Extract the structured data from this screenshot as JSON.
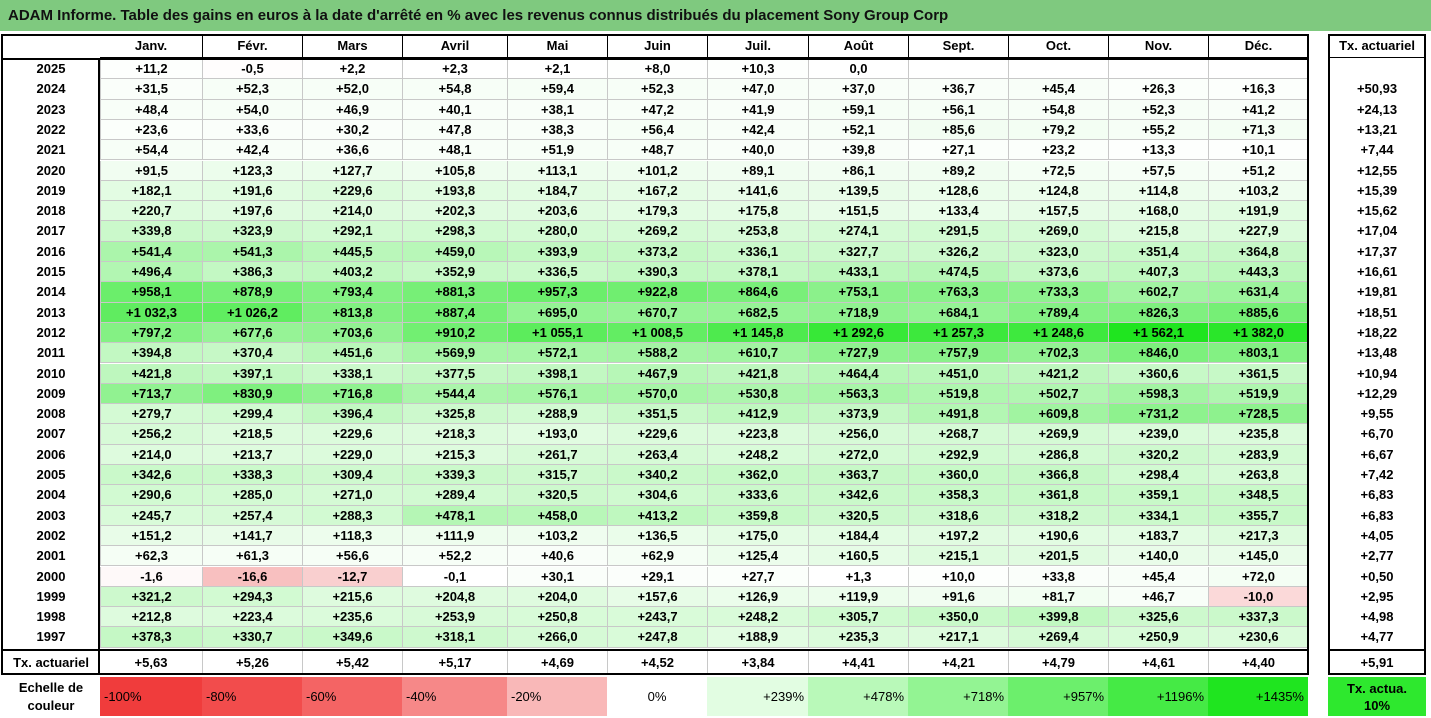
{
  "title": "ADAM Informe. Table des gains en euros à la date d'arrêté en % avec les revenus connus distribués du placement Sony Group Corp",
  "months": [
    "Janv.",
    "Févr.",
    "Mars",
    "Avril",
    "Mai",
    "Juin",
    "Juil.",
    "Août",
    "Sept.",
    "Oct.",
    "Nov.",
    "Déc."
  ],
  "rate_header": "Tx. actuariel",
  "rows": [
    {
      "year": "2025",
      "values": [
        "+11,2",
        "-0,5",
        "+2,2",
        "+2,3",
        "+2,1",
        "+8,0",
        "+10,3",
        "0,0",
        "",
        "",
        "",
        ""
      ],
      "rate": ""
    },
    {
      "year": "2024",
      "values": [
        "+31,5",
        "+52,3",
        "+52,0",
        "+54,8",
        "+59,4",
        "+52,3",
        "+47,0",
        "+37,0",
        "+36,7",
        "+45,4",
        "+26,3",
        "+16,3"
      ],
      "rate": "+50,93"
    },
    {
      "year": "2023",
      "values": [
        "+48,4",
        "+54,0",
        "+46,9",
        "+40,1",
        "+38,1",
        "+47,2",
        "+41,9",
        "+59,1",
        "+56,1",
        "+54,8",
        "+52,3",
        "+41,2"
      ],
      "rate": "+24,13"
    },
    {
      "year": "2022",
      "values": [
        "+23,6",
        "+33,6",
        "+30,2",
        "+47,8",
        "+38,3",
        "+56,4",
        "+42,4",
        "+52,1",
        "+85,6",
        "+79,2",
        "+55,2",
        "+71,3"
      ],
      "rate": "+13,21"
    },
    {
      "year": "2021",
      "values": [
        "+54,4",
        "+42,4",
        "+36,6",
        "+48,1",
        "+51,9",
        "+48,7",
        "+40,0",
        "+39,8",
        "+27,1",
        "+23,2",
        "+13,3",
        "+10,1"
      ],
      "rate": "+7,44"
    },
    {
      "year": "2020",
      "values": [
        "+91,5",
        "+123,3",
        "+127,7",
        "+105,8",
        "+113,1",
        "+101,2",
        "+89,1",
        "+86,1",
        "+89,2",
        "+72,5",
        "+57,5",
        "+51,2"
      ],
      "rate": "+12,55"
    },
    {
      "year": "2019",
      "values": [
        "+182,1",
        "+191,6",
        "+229,6",
        "+193,8",
        "+184,7",
        "+167,2",
        "+141,6",
        "+139,5",
        "+128,6",
        "+124,8",
        "+114,8",
        "+103,2"
      ],
      "rate": "+15,39"
    },
    {
      "year": "2018",
      "values": [
        "+220,7",
        "+197,6",
        "+214,0",
        "+202,3",
        "+203,6",
        "+179,3",
        "+175,8",
        "+151,5",
        "+133,4",
        "+157,5",
        "+168,0",
        "+191,9"
      ],
      "rate": "+15,62"
    },
    {
      "year": "2017",
      "values": [
        "+339,8",
        "+323,9",
        "+292,1",
        "+298,3",
        "+280,0",
        "+269,2",
        "+253,8",
        "+274,1",
        "+291,5",
        "+269,0",
        "+215,8",
        "+227,9"
      ],
      "rate": "+17,04"
    },
    {
      "year": "2016",
      "values": [
        "+541,4",
        "+541,3",
        "+445,5",
        "+459,0",
        "+393,9",
        "+373,2",
        "+336,1",
        "+327,7",
        "+326,2",
        "+323,0",
        "+351,4",
        "+364,8"
      ],
      "rate": "+17,37"
    },
    {
      "year": "2015",
      "values": [
        "+496,4",
        "+386,3",
        "+403,2",
        "+352,9",
        "+336,5",
        "+390,3",
        "+378,1",
        "+433,1",
        "+474,5",
        "+373,6",
        "+407,3",
        "+443,3"
      ],
      "rate": "+16,61"
    },
    {
      "year": "2014",
      "values": [
        "+958,1",
        "+878,9",
        "+793,4",
        "+881,3",
        "+957,3",
        "+922,8",
        "+864,6",
        "+753,1",
        "+763,3",
        "+733,3",
        "+602,7",
        "+631,4"
      ],
      "rate": "+19,81"
    },
    {
      "year": "2013",
      "values": [
        "+1 032,3",
        "+1 026,2",
        "+813,8",
        "+887,4",
        "+695,0",
        "+670,7",
        "+682,5",
        "+718,9",
        "+684,1",
        "+789,4",
        "+826,3",
        "+885,6"
      ],
      "rate": "+18,51"
    },
    {
      "year": "2012",
      "values": [
        "+797,2",
        "+677,6",
        "+703,6",
        "+910,2",
        "+1 055,1",
        "+1 008,5",
        "+1 145,8",
        "+1 292,6",
        "+1 257,3",
        "+1 248,6",
        "+1 562,1",
        "+1 382,0"
      ],
      "rate": "+18,22"
    },
    {
      "year": "2011",
      "values": [
        "+394,8",
        "+370,4",
        "+451,6",
        "+569,9",
        "+572,1",
        "+588,2",
        "+610,7",
        "+727,9",
        "+757,9",
        "+702,3",
        "+846,0",
        "+803,1"
      ],
      "rate": "+13,48"
    },
    {
      "year": "2010",
      "values": [
        "+421,8",
        "+397,1",
        "+338,1",
        "+377,5",
        "+398,1",
        "+467,9",
        "+421,8",
        "+464,4",
        "+451,0",
        "+421,2",
        "+360,6",
        "+361,5"
      ],
      "rate": "+10,94"
    },
    {
      "year": "2009",
      "values": [
        "+713,7",
        "+830,9",
        "+716,8",
        "+544,4",
        "+576,1",
        "+570,0",
        "+530,8",
        "+563,3",
        "+519,8",
        "+502,7",
        "+598,3",
        "+519,9"
      ],
      "rate": "+12,29"
    },
    {
      "year": "2008",
      "values": [
        "+279,7",
        "+299,4",
        "+396,4",
        "+325,8",
        "+288,9",
        "+351,5",
        "+412,9",
        "+373,9",
        "+491,8",
        "+609,8",
        "+731,2",
        "+728,5"
      ],
      "rate": "+9,55"
    },
    {
      "year": "2007",
      "values": [
        "+256,2",
        "+218,5",
        "+229,6",
        "+218,3",
        "+193,0",
        "+229,6",
        "+223,8",
        "+256,0",
        "+268,7",
        "+269,9",
        "+239,0",
        "+235,8"
      ],
      "rate": "+6,70"
    },
    {
      "year": "2006",
      "values": [
        "+214,0",
        "+213,7",
        "+229,0",
        "+215,3",
        "+261,7",
        "+263,4",
        "+248,2",
        "+272,0",
        "+292,9",
        "+286,8",
        "+320,2",
        "+283,9"
      ],
      "rate": "+6,67"
    },
    {
      "year": "2005",
      "values": [
        "+342,6",
        "+338,3",
        "+309,4",
        "+339,3",
        "+315,7",
        "+340,2",
        "+362,0",
        "+363,7",
        "+360,0",
        "+366,8",
        "+298,4",
        "+263,8"
      ],
      "rate": "+7,42"
    },
    {
      "year": "2004",
      "values": [
        "+290,6",
        "+285,0",
        "+271,0",
        "+289,4",
        "+320,5",
        "+304,6",
        "+333,6",
        "+342,6",
        "+358,3",
        "+361,8",
        "+359,1",
        "+348,5"
      ],
      "rate": "+6,83"
    },
    {
      "year": "2003",
      "values": [
        "+245,7",
        "+257,4",
        "+288,3",
        "+478,1",
        "+458,0",
        "+413,2",
        "+359,8",
        "+320,5",
        "+318,6",
        "+318,2",
        "+334,1",
        "+355,7"
      ],
      "rate": "+6,83"
    },
    {
      "year": "2002",
      "values": [
        "+151,2",
        "+141,7",
        "+118,3",
        "+111,9",
        "+103,2",
        "+136,5",
        "+175,0",
        "+184,4",
        "+197,2",
        "+190,6",
        "+183,7",
        "+217,3"
      ],
      "rate": "+4,05"
    },
    {
      "year": "2001",
      "values": [
        "+62,3",
        "+61,3",
        "+56,6",
        "+52,2",
        "+40,6",
        "+62,9",
        "+125,4",
        "+160,5",
        "+215,1",
        "+201,5",
        "+140,0",
        "+145,0"
      ],
      "rate": "+2,77"
    },
    {
      "year": "2000",
      "values": [
        "-1,6",
        "-16,6",
        "-12,7",
        "-0,1",
        "+30,1",
        "+29,1",
        "+27,7",
        "+1,3",
        "+10,0",
        "+33,8",
        "+45,4",
        "+72,0"
      ],
      "rate": "+0,50"
    },
    {
      "year": "1999",
      "values": [
        "+321,2",
        "+294,3",
        "+215,6",
        "+204,8",
        "+204,0",
        "+157,6",
        "+126,9",
        "+119,9",
        "+91,6",
        "+81,7",
        "+46,7",
        "-10,0"
      ],
      "rate": "+2,95"
    },
    {
      "year": "1998",
      "values": [
        "+212,8",
        "+223,4",
        "+235,6",
        "+253,9",
        "+250,8",
        "+243,7",
        "+248,2",
        "+305,7",
        "+350,0",
        "+399,8",
        "+325,6",
        "+337,3"
      ],
      "rate": "+4,98"
    },
    {
      "year": "1997",
      "values": [
        "+378,3",
        "+330,7",
        "+349,6",
        "+318,1",
        "+266,0",
        "+247,8",
        "+188,9",
        "+235,3",
        "+217,1",
        "+269,4",
        "+250,9",
        "+230,6"
      ],
      "rate": "+4,77"
    }
  ],
  "footer": {
    "label": "Tx. actuariel",
    "values": [
      "+5,63",
      "+5,26",
      "+5,42",
      "+5,17",
      "+4,69",
      "+4,52",
      "+3,84",
      "+4,41",
      "+4,21",
      "+4,79",
      "+4,61",
      "+4,40"
    ],
    "rate": "+5,91"
  },
  "legend": {
    "label": "Echelle de couleur",
    "items": [
      {
        "text": "-100%",
        "color": "#f03c3c",
        "align": "left"
      },
      {
        "text": "-80%",
        "color": "#f24c4c",
        "align": "left"
      },
      {
        "text": "-60%",
        "color": "#f46464",
        "align": "left"
      },
      {
        "text": "-40%",
        "color": "#f68888",
        "align": "left"
      },
      {
        "text": "-20%",
        "color": "#f9b8b8",
        "align": "left"
      },
      {
        "text": "0%",
        "color": "#ffffff",
        "align": "center"
      },
      {
        "text": "+239%",
        "color": "#e2fde2",
        "align": "right"
      },
      {
        "text": "+478%",
        "color": "#b9f9b9",
        "align": "right"
      },
      {
        "text": "+718%",
        "color": "#93f493",
        "align": "right"
      },
      {
        "text": "+957%",
        "color": "#6cef6c",
        "align": "right"
      },
      {
        "text": "+1196%",
        "color": "#45ea45",
        "align": "right"
      },
      {
        "text": "+1435%",
        "color": "#1fe51f",
        "align": "right"
      }
    ],
    "rate_text": "Tx. actua. 10%",
    "rate_color": "#2ee82e"
  }
}
